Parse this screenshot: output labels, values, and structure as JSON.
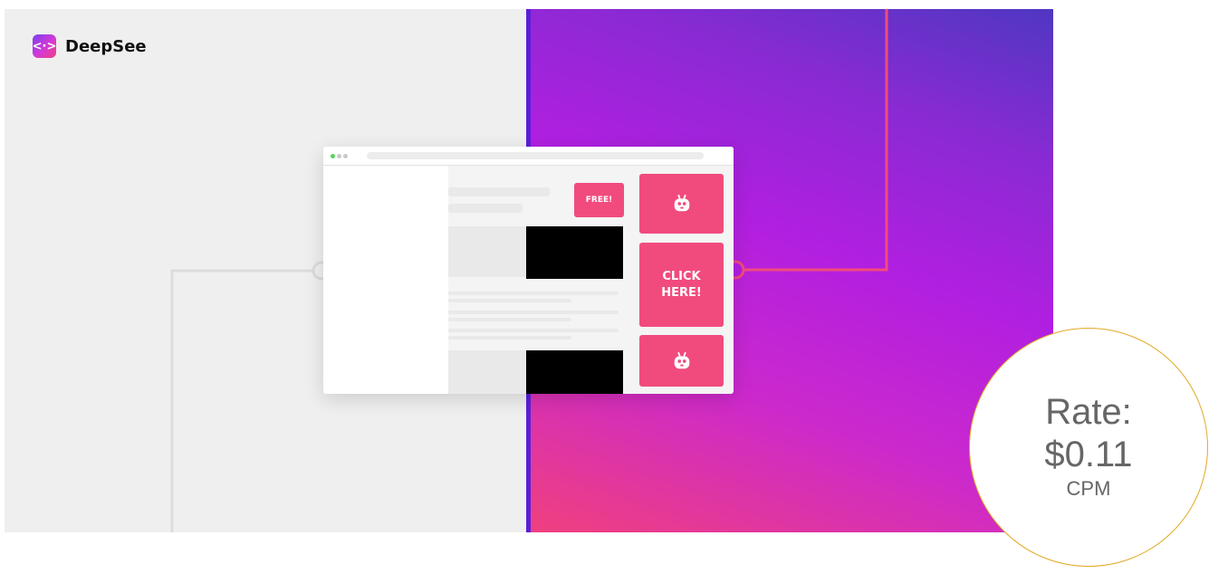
{
  "brand": {
    "name": "DeepSee",
    "logo_glyph": "<·>",
    "logo_icon": "code-brackets-icon"
  },
  "ads": {
    "free_label": "FREE!",
    "click_label": "CLICK HERE!",
    "robot_icon": "robot-icon"
  },
  "rate_badge": {
    "label": "Rate:",
    "value": "$0.11",
    "unit": "CPM"
  },
  "colors": {
    "left_background": "#efefef",
    "divider": "#5a1fd8",
    "gradient_start": "#f0407e",
    "gradient_mid": "#b11fe0",
    "gradient_end": "#4f37c2",
    "ad_pink": "#f14b7e",
    "connector_line": "#f14b7e",
    "badge_border": "#e2a925",
    "badge_text": "#666666"
  }
}
